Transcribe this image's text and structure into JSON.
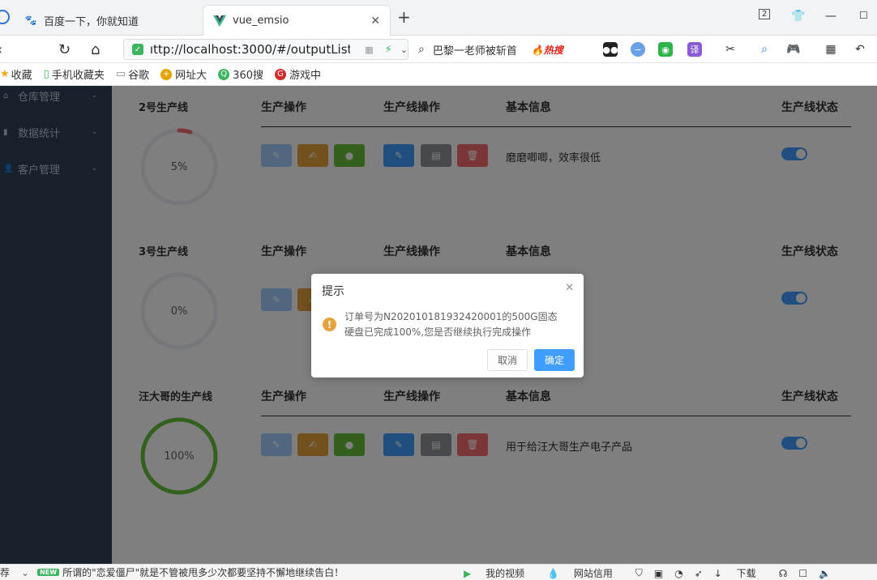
{
  "browser": {
    "tabs": [
      {
        "title": "百度一下，你就知道",
        "active": false,
        "icon": "paw-icon"
      },
      {
        "title": "vue_emsio",
        "active": true,
        "icon": "vue-logo-icon"
      }
    ],
    "tab_counter": "2",
    "url": "ıttp://localhost:3000/#/outputList",
    "search_text": "巴黎一老师被斩首",
    "hot_search_label": "🔥热搜",
    "bookmarks": [
      "收藏",
      "手机收藏夹",
      "谷歌",
      "网址大",
      "360搜",
      "游戏中"
    ]
  },
  "sidebar": {
    "items": [
      {
        "label": "仓库管理"
      },
      {
        "label": "数据统计"
      },
      {
        "label": "客户管理"
      }
    ]
  },
  "columns": {
    "production_op": "生产操作",
    "line_op": "生产线操作",
    "basic_info": "基本信息",
    "status": "生产线状态"
  },
  "production_lines": [
    {
      "name": "2号生产线",
      "progress": 5,
      "progress_label": "5%",
      "info": "磨磨唧唧，效率很低",
      "status_on": true,
      "ring_color": "#f56c6c"
    },
    {
      "name": "3号生产线",
      "progress": 0,
      "progress_label": "0%",
      "info": "",
      "status_on": true,
      "ring_color": "#f56c6c"
    },
    {
      "name": "汪大哥的生产线",
      "progress": 100,
      "progress_label": "100%",
      "info": "用于给汪大哥生产电子产品",
      "status_on": true,
      "ring_color": "#67c23a"
    }
  ],
  "dialog": {
    "title": "提示",
    "message": "订单号为N20201018193242000​1的500G固态硬盘已完成100%,您是否继续执行完成操作",
    "cancel_label": "取消",
    "confirm_label": "确定"
  },
  "statusbar": {
    "left_prefix": "荐",
    "new_badge": "NEW",
    "news": "所谓的\"恋爱僵尸\"就是不管被甩多少次都要坚持不懈地继续告白！",
    "my_video": "我的视频",
    "site_credit": "网站信用",
    "download": "下载"
  },
  "colors": {
    "primary": "#409eff",
    "warning": "#e6a23c",
    "success": "#67c23a",
    "danger": "#f56c6c",
    "sidebar_bg": "#304156"
  }
}
